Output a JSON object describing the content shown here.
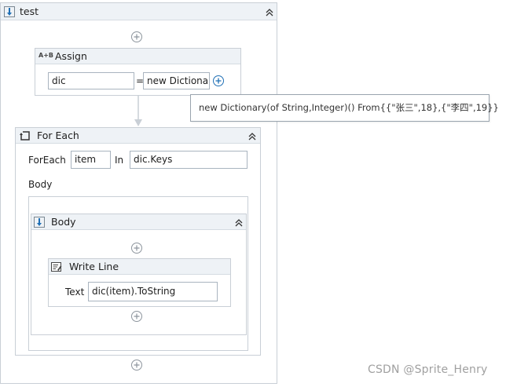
{
  "root": {
    "title": "test"
  },
  "assign": {
    "title": "Assign",
    "icon_text": "A+B",
    "to_value": "dic",
    "equals": "=",
    "value": "new Dictionar",
    "tooltip": "new Dictionary(of String,Integer)() From{{\"张三\",18},{\"李四\",19}}"
  },
  "foreach": {
    "title": "For Each",
    "foreach_label": "ForEach",
    "item_value": "item",
    "in_label": "In",
    "collection_value": "dic.Keys",
    "body_label": "Body"
  },
  "body_sequence": {
    "title": "Body"
  },
  "writeline": {
    "title": "Write Line",
    "text_label": "Text",
    "text_value": "dic(item).ToString"
  },
  "watermark": "CSDN @Sprite_Henry",
  "colors": {
    "header_bg": "#eef2f6",
    "border": "#c9cfd6",
    "accent_blue": "#1f6fb5"
  }
}
